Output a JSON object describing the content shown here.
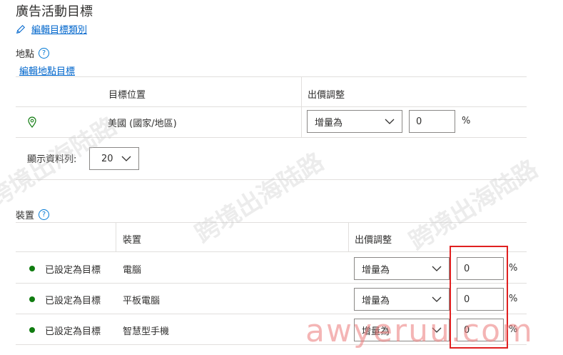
{
  "page": {
    "title": "廣告活動目標",
    "edit_goal_link": "編輯目標類別"
  },
  "location": {
    "section_label": "地點",
    "help_glyph": "?",
    "edit_link": "編輯地點目標",
    "headers": {
      "target": "目標位置",
      "bid": "出價調整"
    },
    "row": {
      "name": "美國 (國家/地區)",
      "bid_mode": "增量為",
      "bid_value": "0",
      "unit": "%"
    },
    "show_rows_label": "顯示資料列:",
    "show_rows_value": "20"
  },
  "device": {
    "section_label": "裝置",
    "help_glyph": "?",
    "headers": {
      "device": "裝置",
      "bid": "出價調整"
    },
    "rows": [
      {
        "status": "已設定為目標",
        "device": "電腦",
        "bid_mode": "增量為",
        "bid_value": "0",
        "unit": "%"
      },
      {
        "status": "已設定為目標",
        "device": "平板電腦",
        "bid_mode": "增量為",
        "bid_value": "0",
        "unit": "%"
      },
      {
        "status": "已設定為目標",
        "device": "智慧型手機",
        "bid_mode": "增量為",
        "bid_value": "0",
        "unit": "%"
      }
    ]
  },
  "watermark": {
    "chinese": "跨境出海陆路",
    "latin": "awyeruu.com"
  },
  "colors": {
    "link": "#0066cc",
    "status_dot": "#107c10",
    "highlight": "#e02020",
    "divider": "#e1dfdd"
  },
  "icons": {
    "edit": "pencil-icon",
    "help": "help-circle-icon",
    "location": "map-pin-icon",
    "dropdown": "chevron-down-icon"
  }
}
